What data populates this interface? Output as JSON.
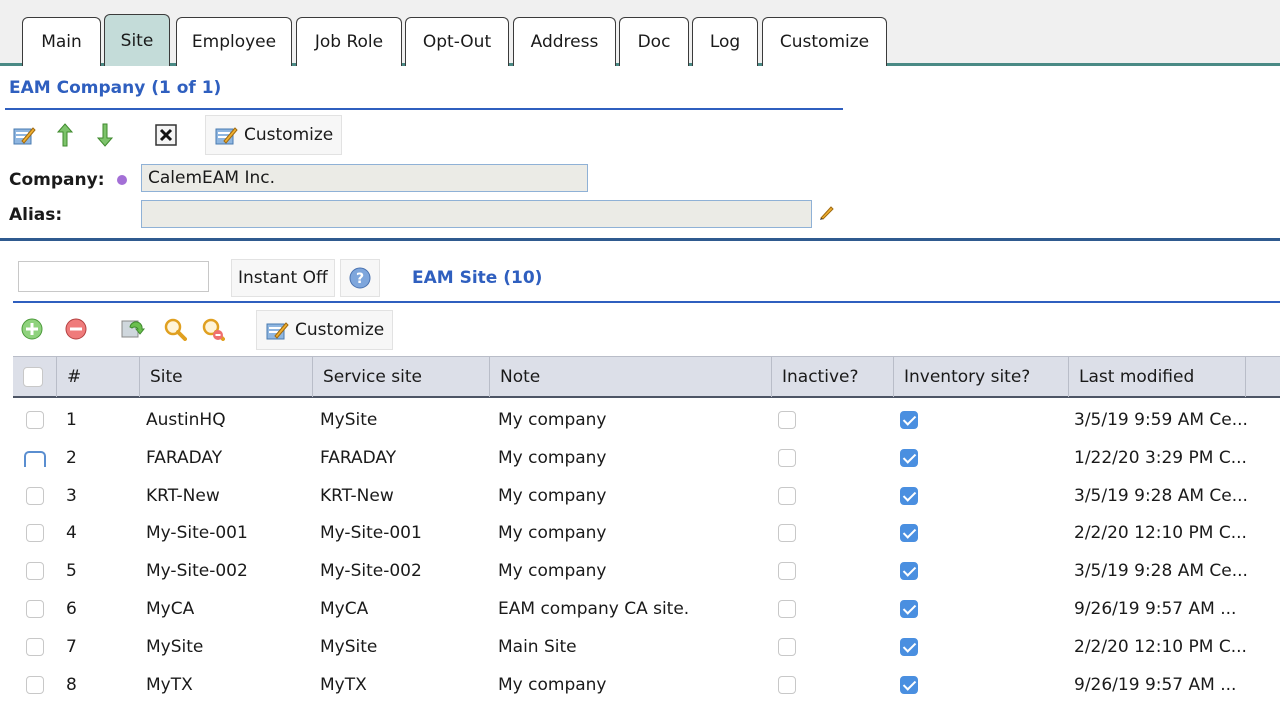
{
  "tabs": [
    {
      "label": "Main",
      "active": false
    },
    {
      "label": "Site",
      "active": true
    },
    {
      "label": "Employee",
      "active": false
    },
    {
      "label": "Job Role",
      "active": false
    },
    {
      "label": "Opt-Out",
      "active": false
    },
    {
      "label": "Address",
      "active": false
    },
    {
      "label": "Doc",
      "active": false
    },
    {
      "label": "Log",
      "active": false
    },
    {
      "label": "Customize",
      "active": false
    }
  ],
  "company": {
    "title": "EAM Company (1 of 1)",
    "customize_label": "Customize",
    "company_label": "Company:",
    "company_value": "CalemEAM Inc.",
    "alias_label": "Alias:",
    "alias_value": ""
  },
  "site_grid": {
    "search_value": "",
    "instant_label": "Instant Off",
    "title": "EAM Site (10)",
    "customize_label": "Customize",
    "columns": [
      "#",
      "Site",
      "Service site",
      "Note",
      "Inactive?",
      "Inventory site?",
      "Last modified"
    ],
    "rows": [
      {
        "num": "1",
        "site": "AustinHQ",
        "service": "MySite",
        "note": "My company",
        "inactive": false,
        "inventory": true,
        "modified": "3/5/19 9:59 AM Ce...",
        "selected": false
      },
      {
        "num": "2",
        "site": "FARADAY",
        "service": "FARADAY",
        "note": "My company",
        "inactive": false,
        "inventory": true,
        "modified": "1/22/20 3:29 PM C...",
        "selected": true
      },
      {
        "num": "3",
        "site": "KRT-New",
        "service": "KRT-New",
        "note": "My company",
        "inactive": false,
        "inventory": true,
        "modified": "3/5/19 9:28 AM Ce...",
        "selected": false
      },
      {
        "num": "4",
        "site": "My-Site-001",
        "service": "My-Site-001",
        "note": "My company",
        "inactive": false,
        "inventory": true,
        "modified": "2/2/20 12:10 PM C...",
        "selected": false
      },
      {
        "num": "5",
        "site": "My-Site-002",
        "service": "My-Site-002",
        "note": "My company",
        "inactive": false,
        "inventory": true,
        "modified": "3/5/19 9:28 AM Ce...",
        "selected": false
      },
      {
        "num": "6",
        "site": "MyCA",
        "service": "MyCA",
        "note": "EAM company CA site.",
        "inactive": false,
        "inventory": true,
        "modified": "9/26/19 9:57 AM ...",
        "selected": false
      },
      {
        "num": "7",
        "site": "MySite",
        "service": "MySite",
        "note": "Main Site",
        "inactive": false,
        "inventory": true,
        "modified": "2/2/20 12:10 PM C...",
        "selected": false
      },
      {
        "num": "8",
        "site": "MyTX",
        "service": "MyTX",
        "note": "My company",
        "inactive": false,
        "inventory": true,
        "modified": "9/26/19 9:57 AM ...",
        "selected": false
      }
    ]
  },
  "colors": {
    "accent_blue": "#2f5fbf",
    "active_tab": "#c4dcd9",
    "checkbox_checked": "#4a8fe0",
    "header_bg": "#dcdfe8"
  }
}
